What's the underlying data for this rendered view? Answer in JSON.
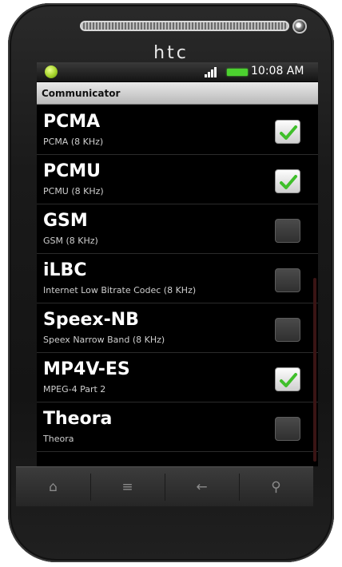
{
  "device": {
    "brand": "htc"
  },
  "status_bar": {
    "time": "10:08 AM",
    "notification_icon": "android-notification-icon",
    "signal_icon": "signal-strength-icon",
    "battery_icon": "battery-icon"
  },
  "app": {
    "title": "Communicator"
  },
  "codecs": [
    {
      "name": "PCMA",
      "description": "PCMA (8 KHz)",
      "enabled": true
    },
    {
      "name": "PCMU",
      "description": "PCMU (8 KHz)",
      "enabled": true
    },
    {
      "name": "GSM",
      "description": "GSM (8 KHz)",
      "enabled": false
    },
    {
      "name": "iLBC",
      "description": "Internet Low Bitrate Codec (8 KHz)",
      "enabled": false
    },
    {
      "name": "Speex-NB",
      "description": "Speex Narrow Band (8 KHz)",
      "enabled": false
    },
    {
      "name": "MP4V-ES",
      "description": "MPEG-4 Part 2",
      "enabled": true
    },
    {
      "name": "Theora",
      "description": "Theora",
      "enabled": false
    }
  ],
  "nav_buttons": [
    {
      "name": "home",
      "glyph": "⌂"
    },
    {
      "name": "menu",
      "glyph": "≡"
    },
    {
      "name": "back",
      "glyph": "←"
    },
    {
      "name": "search",
      "glyph": "⚲"
    }
  ],
  "colors": {
    "check_green": "#3fbf2a",
    "battery_green": "#4cd12f",
    "titlebar_bg": "#d4d4d4"
  }
}
